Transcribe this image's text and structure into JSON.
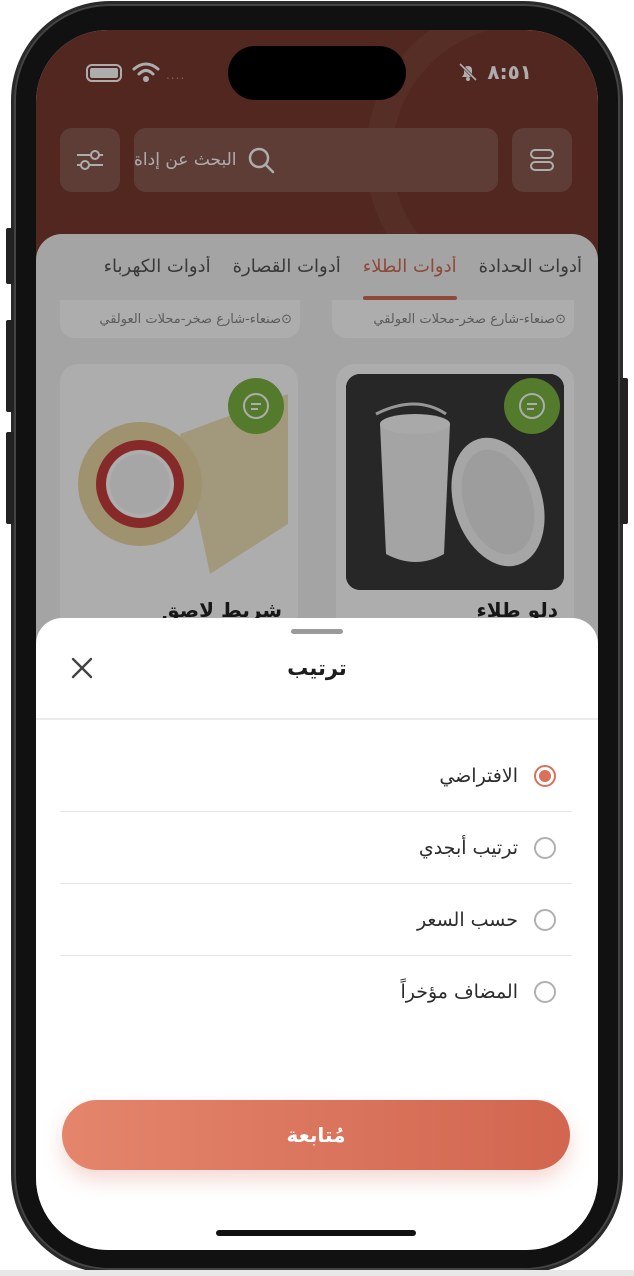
{
  "status_bar": {
    "time": "٨:٥١",
    "signal_dots": "....",
    "icons": [
      "battery-icon",
      "wifi-icon",
      "bell-off-icon"
    ]
  },
  "header": {
    "search_placeholder": "البحث عن إداة",
    "filter_icon": "sliders-icon",
    "menu_icon": "list-toggle-icon",
    "search_icon": "search-icon",
    "bg_color": "#7a3a2f"
  },
  "tabs": [
    {
      "label": "أدوات الحدادة",
      "active": false
    },
    {
      "label": "أدوات الطلاء",
      "active": true
    },
    {
      "label": "أدوات القصارة",
      "active": false
    },
    {
      "label": "أدوات الكهرباء",
      "active": false
    }
  ],
  "location_chips": [
    "صنعاء-شارع صخر-محلات العولقي",
    "صنعاء-شارع صخر-محلات العولقي"
  ],
  "products": [
    {
      "title": "دلو طلاء",
      "image": "paint-bucket",
      "chat_icon": "chat-icon"
    },
    {
      "title": "شريط لاصق",
      "image": "tape-roll",
      "chat_icon": "chat-icon"
    }
  ],
  "sort_sheet": {
    "title": "ترتيب",
    "close_icon": "close-icon",
    "options": [
      {
        "label": "الافتراضي",
        "selected": true
      },
      {
        "label": "ترتيب أبجدي",
        "selected": false
      },
      {
        "label": "حسب السعر",
        "selected": false
      },
      {
        "label": "المضاف مؤخراً",
        "selected": false
      }
    ],
    "continue_label": "مُتابعة"
  },
  "colors": {
    "accent": "#d9705a",
    "chat_green": "#7db542"
  }
}
